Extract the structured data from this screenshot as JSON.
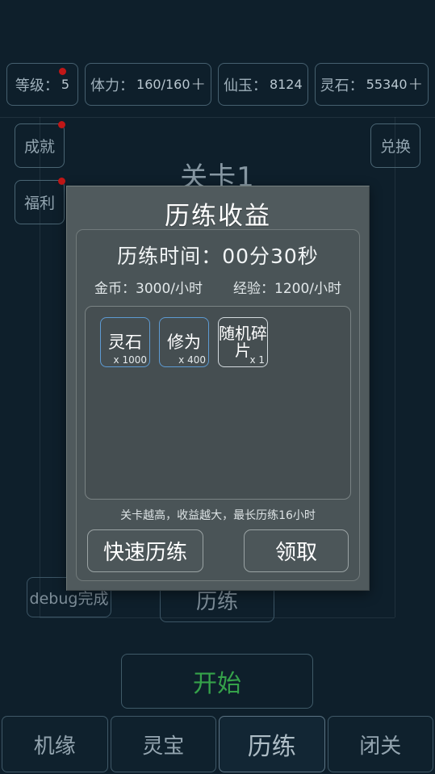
{
  "background": {
    "stage_title": "关卡1",
    "debug_button": "debug完成",
    "training_button": "历练",
    "start_button": "开始"
  },
  "stats": [
    {
      "label": "等级：",
      "value": "5",
      "has_plus": false,
      "has_dot": true
    },
    {
      "label": "体力：",
      "value": "160/160",
      "has_plus": true,
      "has_dot": false
    },
    {
      "label": "仙玉：",
      "value": "8124",
      "has_plus": false,
      "has_dot": false
    },
    {
      "label": "灵石：",
      "value": "55340",
      "has_plus": true,
      "has_dot": false
    }
  ],
  "side_buttons": {
    "achievement": "成就",
    "welfare": "福利",
    "exchange": "兑换"
  },
  "dialog": {
    "title": "历练收益",
    "time_label": "历练时间：",
    "time_value": "00分30秒",
    "rates": [
      {
        "label": "金币：",
        "value": "3000/小时"
      },
      {
        "label": "经验：",
        "value": "1200/小时"
      }
    ],
    "rewards": [
      {
        "name": "灵石",
        "qty": "x 1000",
        "border": "blue",
        "lines": 1
      },
      {
        "name": "修为",
        "qty": "x 400",
        "border": "blue",
        "lines": 1
      },
      {
        "name": "随机碎片",
        "qty": "x 1",
        "border": "white",
        "lines": 2
      }
    ],
    "hint": "关卡越高，收益越大，最长历练16小时",
    "quick_button": "快速历练",
    "claim_button": "领取"
  },
  "bottom_nav": [
    {
      "label": "机缘",
      "active": false
    },
    {
      "label": "灵宝",
      "active": false
    },
    {
      "label": "历练",
      "active": true
    },
    {
      "label": "闭关",
      "active": false
    }
  ],
  "colors": {
    "background": "#0e1f2b",
    "accent_blue": "#5d9ad2",
    "start_green": "#35a24a",
    "badge_red": "#c01717",
    "dialog_bg": "#505a5d"
  }
}
